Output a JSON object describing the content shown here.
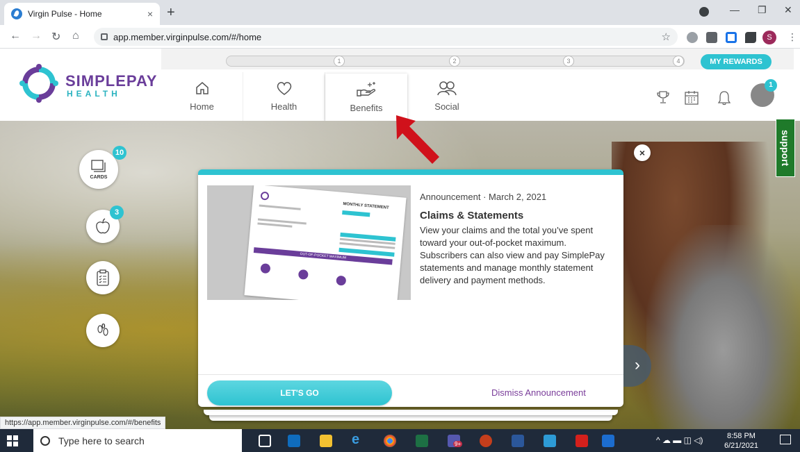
{
  "browser": {
    "tab_title": "Virgin Pulse - Home",
    "tab_close": "×",
    "new_tab": "+",
    "url": "app.member.virginpulse.com/#/home",
    "profile_initial": "S",
    "status_url": "https://app.member.virginpulse.com/#/benefits"
  },
  "brand": {
    "name_line1": "SIMPLEPAY",
    "name_line2": "HEALTH",
    "accent": "#2ec3d1",
    "purple": "#6a3d9a"
  },
  "progress": {
    "steps": [
      "1",
      "2",
      "3",
      "4"
    ],
    "rewards_label": "MY REWARDS"
  },
  "nav": {
    "items": [
      {
        "label": "Home",
        "icon": "home-icon"
      },
      {
        "label": "Health",
        "icon": "heart-icon"
      },
      {
        "label": "Benefits",
        "icon": "hand-sparkle-icon"
      },
      {
        "label": "Social",
        "icon": "people-icon"
      }
    ],
    "active": "Benefits",
    "notification_count": "1"
  },
  "side": {
    "cards_label": "CARDS",
    "cards_count": "10",
    "nutrition_count": "3",
    "steps_count": "0"
  },
  "support_label": "support",
  "announcement": {
    "type": "Announcement",
    "separator": "·",
    "date": "March 2, 2021",
    "title": "Claims & Statements",
    "body": "View your claims and the total you’ve spent toward your out-of-pocket maximum. Subscribers can also view and pay SimplePay statements and manage monthly statement delivery and payment methods.",
    "cta": "LET'S GO",
    "dismiss": "Dismiss Announcement",
    "close": "×",
    "next": "›",
    "thumb_heading": "MONTHLY STATEMENT",
    "thumb_bar": "OUT-OF-POCKET MAXIMUM"
  },
  "taskbar": {
    "search_placeholder": "Type here to search",
    "time": "8:58 PM",
    "date": "6/21/2021",
    "teams_badge": "9+"
  }
}
